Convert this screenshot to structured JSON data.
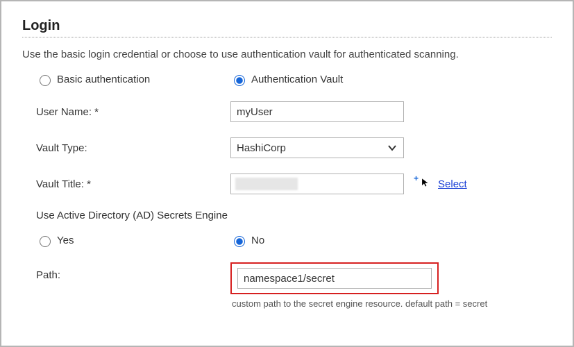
{
  "section": {
    "title": "Login",
    "description": "Use the basic login credential or choose to use authentication vault for authenticated scanning."
  },
  "auth_mode": {
    "basic_label": "Basic authentication",
    "vault_label": "Authentication Vault",
    "selected": "vault"
  },
  "user_name": {
    "label": "User Name: *",
    "value": "myUser"
  },
  "vault_type": {
    "label": "Vault Type:",
    "value": "HashiCorp"
  },
  "vault_title": {
    "label": "Vault Title: *",
    "select_link": "Select"
  },
  "ad_engine": {
    "question": "Use Active Directory (AD) Secrets Engine",
    "yes_label": "Yes",
    "no_label": "No",
    "selected": "no"
  },
  "path": {
    "label": "Path:",
    "value": "namespace1/secret",
    "help": "custom path to the secret engine resource. default path = secret"
  }
}
